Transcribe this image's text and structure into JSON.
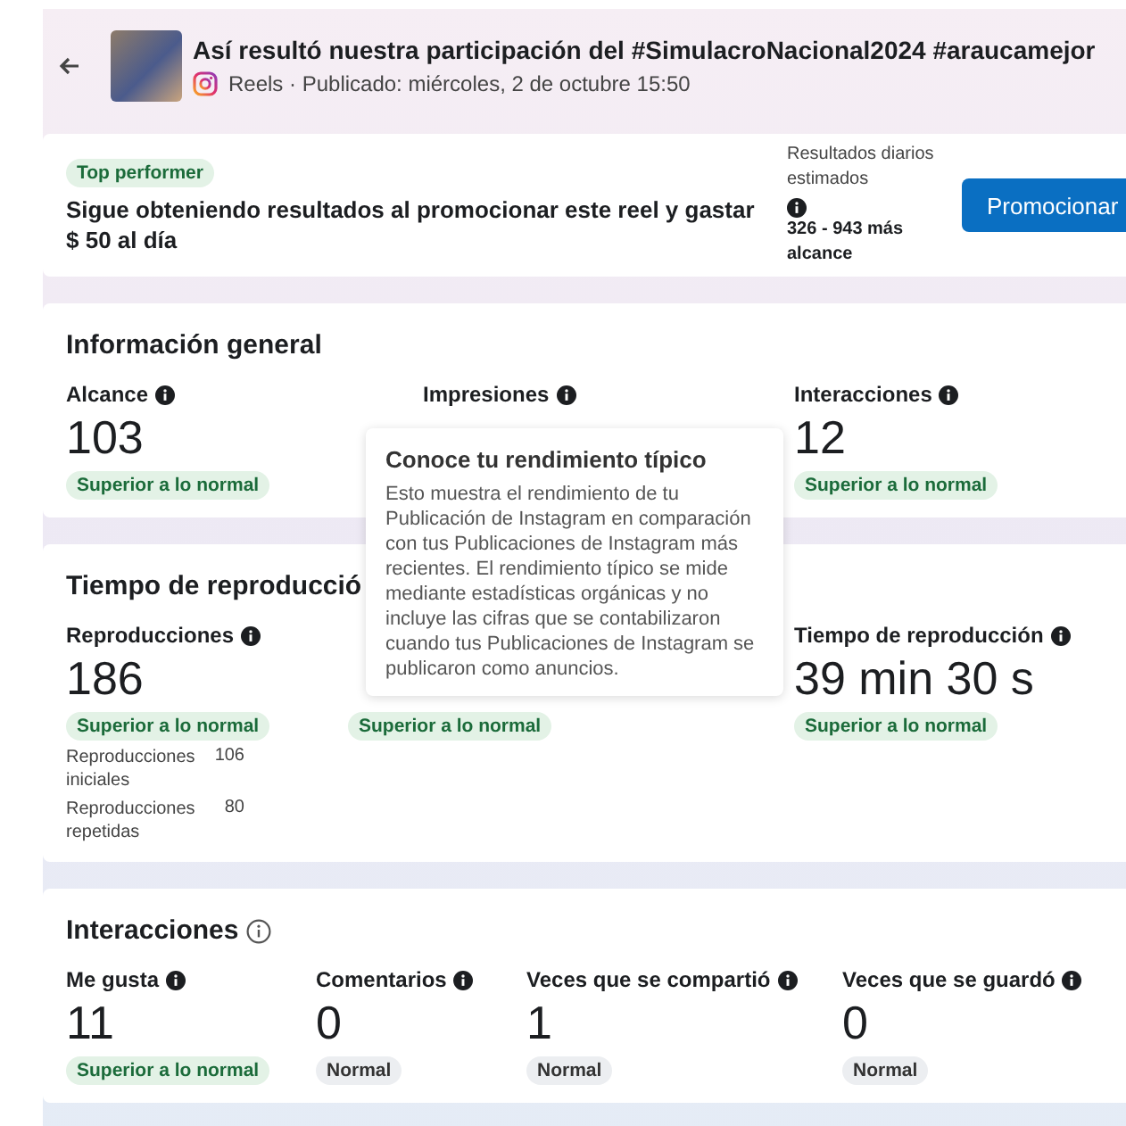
{
  "header": {
    "title": "Así resultó nuestra participación del #SimulacroNacional2024 #araucamejor",
    "source": "Reels · Publicado: miércoles, 2 de octubre 15:50"
  },
  "promo": {
    "badge": "Top performer",
    "message": "Sigue obteniendo resultados al promocionar este reel y gastar $ 50 al día",
    "estimate_label": "Resultados diarios estimados",
    "estimate_value": "326 - 943 más alcance",
    "button": "Promocionar"
  },
  "sections": [
    {
      "title": "Información general",
      "title_info": false,
      "metrics": [
        {
          "label": "Alcance",
          "value": "103",
          "badge": {
            "text": "Superior a lo normal",
            "kind": "above"
          }
        },
        {
          "label": "Impresiones"
        },
        {
          "label": "Interacciones",
          "value": "12",
          "badge": {
            "text": "Superior a lo normal",
            "kind": "above"
          }
        }
      ]
    },
    {
      "title": "Tiempo de reproducció",
      "title_info": false,
      "metrics": [
        {
          "label": "Reproducciones",
          "value": "186",
          "badge": {
            "text": "Superior a lo normal",
            "kind": "above"
          },
          "breakdown": [
            {
              "label": "Reproducciones iniciales",
              "value": "106"
            },
            {
              "label": "Reproducciones repetidas",
              "value": "80"
            }
          ]
        },
        {
          "badge": {
            "text": "Superior a lo normal",
            "kind": "above"
          }
        },
        {
          "label": "Tiempo de reproducción",
          "value": "39 min 30 s",
          "badge": {
            "text": "Superior a lo normal",
            "kind": "above"
          }
        }
      ]
    },
    {
      "title": "Interacciones",
      "title_info": true,
      "metrics": [
        {
          "label": "Me gusta",
          "value": "11",
          "badge": {
            "text": "Superior a lo normal",
            "kind": "above"
          }
        },
        {
          "label": "Comentarios",
          "value": "0",
          "badge": {
            "text": "Normal",
            "kind": "normal"
          }
        },
        {
          "label": "Veces que se compartió",
          "value": "1",
          "badge": {
            "text": "Normal",
            "kind": "normal"
          }
        },
        {
          "label": "Veces que se guardó",
          "value": "0",
          "badge": {
            "text": "Normal",
            "kind": "normal"
          }
        }
      ]
    }
  ],
  "tooltip": {
    "title": "Conoce tu rendimiento típico",
    "text": "Esto muestra el rendimiento de tu Publicación de Instagram en comparación con tus Publicaciones de Instagram más recientes. El rendimiento típico se mide mediante estadísticas orgánicas y no incluye las cifras que se contabilizaron cuando tus Publicaciones de Instagram se publicaron como anuncios."
  }
}
